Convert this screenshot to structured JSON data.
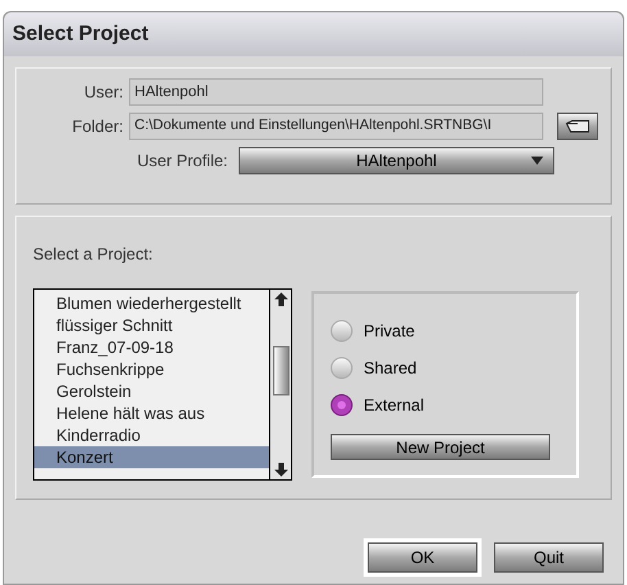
{
  "window": {
    "title": "Select Project"
  },
  "user": {
    "label": "User:",
    "value": "HAltenpohl"
  },
  "folder": {
    "label": "Folder:",
    "value": "C:\\Dokumente und Einstellungen\\HAltenpohl.SRTNBG\\I"
  },
  "user_profile": {
    "label": "User Profile:",
    "value": "HAltenpohl"
  },
  "project_list": {
    "label": "Select a Project:",
    "items": [
      {
        "text": "Blumen wiederhergestellt",
        "selected": false
      },
      {
        "text": "flüssiger Schnitt",
        "selected": false
      },
      {
        "text": "Franz_07-09-18",
        "selected": false
      },
      {
        "text": "Fuchsenkrippe",
        "selected": false
      },
      {
        "text": "Gerolstein",
        "selected": false
      },
      {
        "text": "Helene hält was aus",
        "selected": false
      },
      {
        "text": "Kinderradio",
        "selected": false
      },
      {
        "text": "Konzert",
        "selected": true
      }
    ]
  },
  "project_types": [
    {
      "label": "Private",
      "selected": false
    },
    {
      "label": "Shared",
      "selected": false
    },
    {
      "label": "External",
      "selected": true
    }
  ],
  "new_project_button": "New Project",
  "buttons": [
    {
      "label": "OK",
      "default": true
    },
    {
      "label": "Quit",
      "default": false
    }
  ]
}
